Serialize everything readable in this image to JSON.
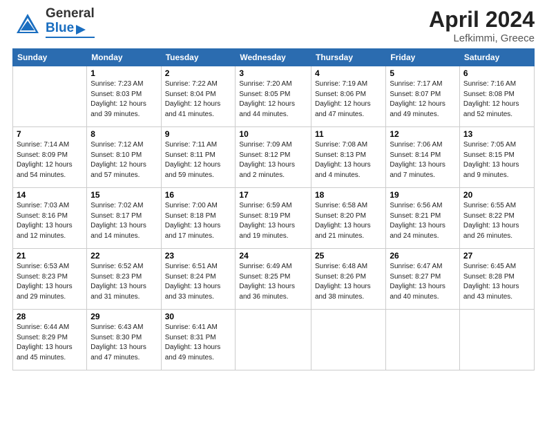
{
  "header": {
    "logo_general": "General",
    "logo_blue": "Blue",
    "month_title": "April 2024",
    "subtitle": "Lefkimmi, Greece"
  },
  "days_of_week": [
    "Sunday",
    "Monday",
    "Tuesday",
    "Wednesday",
    "Thursday",
    "Friday",
    "Saturday"
  ],
  "weeks": [
    [
      {
        "day": "",
        "info": ""
      },
      {
        "day": "1",
        "info": "Sunrise: 7:23 AM\nSunset: 8:03 PM\nDaylight: 12 hours\nand 39 minutes."
      },
      {
        "day": "2",
        "info": "Sunrise: 7:22 AM\nSunset: 8:04 PM\nDaylight: 12 hours\nand 41 minutes."
      },
      {
        "day": "3",
        "info": "Sunrise: 7:20 AM\nSunset: 8:05 PM\nDaylight: 12 hours\nand 44 minutes."
      },
      {
        "day": "4",
        "info": "Sunrise: 7:19 AM\nSunset: 8:06 PM\nDaylight: 12 hours\nand 47 minutes."
      },
      {
        "day": "5",
        "info": "Sunrise: 7:17 AM\nSunset: 8:07 PM\nDaylight: 12 hours\nand 49 minutes."
      },
      {
        "day": "6",
        "info": "Sunrise: 7:16 AM\nSunset: 8:08 PM\nDaylight: 12 hours\nand 52 minutes."
      }
    ],
    [
      {
        "day": "7",
        "info": "Sunrise: 7:14 AM\nSunset: 8:09 PM\nDaylight: 12 hours\nand 54 minutes."
      },
      {
        "day": "8",
        "info": "Sunrise: 7:12 AM\nSunset: 8:10 PM\nDaylight: 12 hours\nand 57 minutes."
      },
      {
        "day": "9",
        "info": "Sunrise: 7:11 AM\nSunset: 8:11 PM\nDaylight: 12 hours\nand 59 minutes."
      },
      {
        "day": "10",
        "info": "Sunrise: 7:09 AM\nSunset: 8:12 PM\nDaylight: 13 hours\nand 2 minutes."
      },
      {
        "day": "11",
        "info": "Sunrise: 7:08 AM\nSunset: 8:13 PM\nDaylight: 13 hours\nand 4 minutes."
      },
      {
        "day": "12",
        "info": "Sunrise: 7:06 AM\nSunset: 8:14 PM\nDaylight: 13 hours\nand 7 minutes."
      },
      {
        "day": "13",
        "info": "Sunrise: 7:05 AM\nSunset: 8:15 PM\nDaylight: 13 hours\nand 9 minutes."
      }
    ],
    [
      {
        "day": "14",
        "info": "Sunrise: 7:03 AM\nSunset: 8:16 PM\nDaylight: 13 hours\nand 12 minutes."
      },
      {
        "day": "15",
        "info": "Sunrise: 7:02 AM\nSunset: 8:17 PM\nDaylight: 13 hours\nand 14 minutes."
      },
      {
        "day": "16",
        "info": "Sunrise: 7:00 AM\nSunset: 8:18 PM\nDaylight: 13 hours\nand 17 minutes."
      },
      {
        "day": "17",
        "info": "Sunrise: 6:59 AM\nSunset: 8:19 PM\nDaylight: 13 hours\nand 19 minutes."
      },
      {
        "day": "18",
        "info": "Sunrise: 6:58 AM\nSunset: 8:20 PM\nDaylight: 13 hours\nand 21 minutes."
      },
      {
        "day": "19",
        "info": "Sunrise: 6:56 AM\nSunset: 8:21 PM\nDaylight: 13 hours\nand 24 minutes."
      },
      {
        "day": "20",
        "info": "Sunrise: 6:55 AM\nSunset: 8:22 PM\nDaylight: 13 hours\nand 26 minutes."
      }
    ],
    [
      {
        "day": "21",
        "info": "Sunrise: 6:53 AM\nSunset: 8:23 PM\nDaylight: 13 hours\nand 29 minutes."
      },
      {
        "day": "22",
        "info": "Sunrise: 6:52 AM\nSunset: 8:23 PM\nDaylight: 13 hours\nand 31 minutes."
      },
      {
        "day": "23",
        "info": "Sunrise: 6:51 AM\nSunset: 8:24 PM\nDaylight: 13 hours\nand 33 minutes."
      },
      {
        "day": "24",
        "info": "Sunrise: 6:49 AM\nSunset: 8:25 PM\nDaylight: 13 hours\nand 36 minutes."
      },
      {
        "day": "25",
        "info": "Sunrise: 6:48 AM\nSunset: 8:26 PM\nDaylight: 13 hours\nand 38 minutes."
      },
      {
        "day": "26",
        "info": "Sunrise: 6:47 AM\nSunset: 8:27 PM\nDaylight: 13 hours\nand 40 minutes."
      },
      {
        "day": "27",
        "info": "Sunrise: 6:45 AM\nSunset: 8:28 PM\nDaylight: 13 hours\nand 43 minutes."
      }
    ],
    [
      {
        "day": "28",
        "info": "Sunrise: 6:44 AM\nSunset: 8:29 PM\nDaylight: 13 hours\nand 45 minutes."
      },
      {
        "day": "29",
        "info": "Sunrise: 6:43 AM\nSunset: 8:30 PM\nDaylight: 13 hours\nand 47 minutes."
      },
      {
        "day": "30",
        "info": "Sunrise: 6:41 AM\nSunset: 8:31 PM\nDaylight: 13 hours\nand 49 minutes."
      },
      {
        "day": "",
        "info": ""
      },
      {
        "day": "",
        "info": ""
      },
      {
        "day": "",
        "info": ""
      },
      {
        "day": "",
        "info": ""
      }
    ]
  ]
}
